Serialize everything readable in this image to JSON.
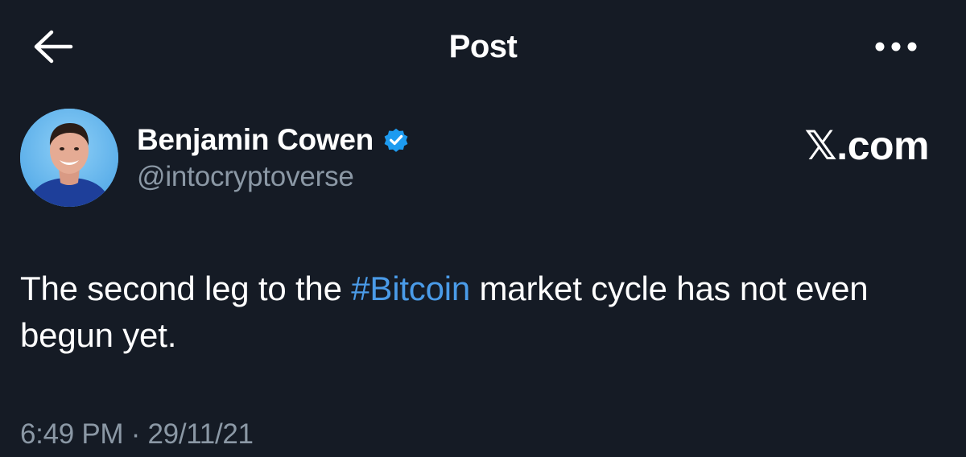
{
  "header": {
    "title": "Post",
    "back_icon": "arrow-left-icon",
    "more_icon": "more-horizontal-icon"
  },
  "author": {
    "name": "Benjamin Cowen",
    "handle": "@intocryptoverse",
    "verified": true,
    "verified_color": "#1d9bf0"
  },
  "watermark": "𝕏.com",
  "post": {
    "text_before": "The second leg to the ",
    "hashtag": "#Bitcoin",
    "text_after": " market cycle has not even begun yet."
  },
  "meta": {
    "time": "6:49 PM",
    "separator": "·",
    "date": "29/11/21"
  },
  "colors": {
    "background": "#151b25",
    "text": "#ffffff",
    "muted": "#8b98a5",
    "link": "#4a9be8"
  }
}
